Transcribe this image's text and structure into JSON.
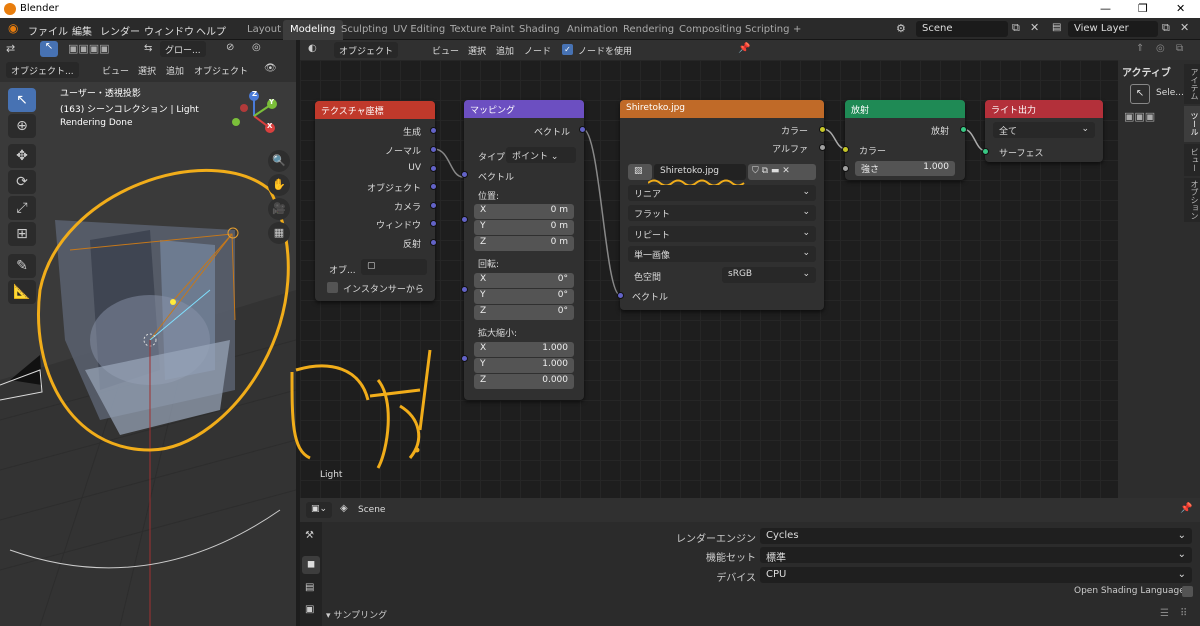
{
  "window": {
    "title": "Blender",
    "min": "—",
    "max": "❐",
    "close": "✕"
  },
  "menu": {
    "file": "ファイル",
    "edit": "編集",
    "render": "レンダー",
    "window": "ウィンドウ",
    "help": "ヘルプ"
  },
  "workspaces": [
    "Layout",
    "Modeling",
    "Sculpting",
    "UV Editing",
    "Texture Paint",
    "Shading",
    "Animation",
    "Rendering",
    "Compositing",
    "Scripting",
    "+"
  ],
  "scene": "Scene",
  "view_layer": "View Layer",
  "viewport": {
    "global": "グロー...",
    "mode": "オブジェクト...",
    "view": "ビュー",
    "select": "選択",
    "add": "追加",
    "object": "オブジェクト",
    "overlay_title": "ユーザー・透視投影",
    "collection_info": "(163) シーンコレクション | Light",
    "status": "Rendering Done",
    "annotation": "でた!",
    "axes": {
      "x": "X",
      "y": "Y",
      "z": "Z"
    }
  },
  "node_editor": {
    "type": "オブジェクト",
    "view": "ビュー",
    "select": "選択",
    "add": "追加",
    "node": "ノード",
    "use_nodes": "ノードを使用",
    "object_label": "Light",
    "nodes": {
      "texcoord": {
        "title": "テクスチャ座標",
        "outputs": [
          "生成",
          "ノーマル",
          "UV",
          "オブジェクト",
          "カメラ",
          "ウィンドウ",
          "反射"
        ],
        "object": "オブ...",
        "from_instancer": "インスタンサーから"
      },
      "mapping": {
        "title": "マッピング",
        "output": "ベクトル",
        "type_label": "タイプ:",
        "type_value": "ポイント",
        "vector": "ベクトル",
        "location": "位置:",
        "rotation": "回転:",
        "scale": "拡大縮小:",
        "loc": [
          [
            "X",
            "0 m"
          ],
          [
            "Y",
            "0 m"
          ],
          [
            "Z",
            "0 m"
          ]
        ],
        "rot": [
          [
            "X",
            "0°"
          ],
          [
            "Y",
            "0°"
          ],
          [
            "Z",
            "0°"
          ]
        ],
        "scl": [
          [
            "X",
            "1.000"
          ],
          [
            "Y",
            "1.000"
          ],
          [
            "Z",
            "0.000"
          ]
        ]
      },
      "image": {
        "title": "Shiretoko.jpg",
        "color": "カラー",
        "alpha": "アルファ",
        "image_name": "Shiretoko.jpg",
        "interp": "リニア",
        "proj": "フラット",
        "ext": "リピート",
        "source": "単一画像",
        "colorspace_label": "色空間",
        "colorspace": "sRGB",
        "vector": "ベクトル"
      },
      "emission": {
        "title": "放射",
        "out": "放射",
        "color": "カラー",
        "strength_label": "強さ",
        "strength": "1.000"
      },
      "output": {
        "title": "ライト出力",
        "target": "全て",
        "surface": "サーフェス"
      }
    }
  },
  "sidebar": {
    "active_tool": "アクティブ",
    "sele": "Sele...",
    "tabs": [
      "アイテム",
      "ツール",
      "ビュー",
      "オプション"
    ]
  },
  "properties": {
    "scene": "Scene",
    "engine_label": "レンダーエンジン",
    "engine": "Cycles",
    "featureset_label": "機能セット",
    "featureset": "標準",
    "device_label": "デバイス",
    "device": "CPU",
    "osl": "Open Shading Language",
    "sampling": "サンプリング"
  },
  "colors": {
    "texcoord": "#c0392b",
    "mapping": "#6c4fc1",
    "image": "#c06a28",
    "emission": "#1f8a55",
    "output": "#b3303a",
    "annotation": "#f1ad1a"
  }
}
